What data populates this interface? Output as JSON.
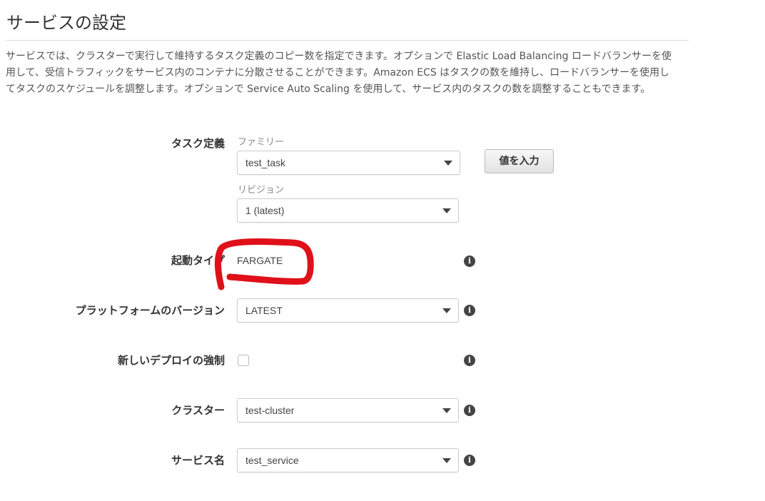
{
  "page": {
    "title": "サービスの設定",
    "description": "サービスでは、クラスターで実行して維持するタスク定義のコピー数を指定できます。オプションで Elastic Load Balancing ロードバランサーを使用して、受信トラフィックをサービス内のコンテナに分散させることができます。Amazon ECS はタスクの数を維持し、ロードバランサーを使用してタスクのスケジュールを調整します。オプションで Service Auto Scaling を使用して、サービス内のタスクの数を調整することもできます。"
  },
  "task_definition": {
    "label": "タスク定義",
    "family_label": "ファミリー",
    "family_value": "test_task",
    "enter_value_button": "値を入力",
    "revision_label": "リビジョン",
    "revision_value": "1 (latest)"
  },
  "launch_type": {
    "label": "起動タイプ",
    "value": "FARGATE",
    "annotation_color": "#e0101a"
  },
  "platform_version": {
    "label": "プラットフォームのバージョン",
    "value": "LATEST"
  },
  "force_new_deployment": {
    "label": "新しいデプロイの強制",
    "checked": false
  },
  "cluster": {
    "label": "クラスター",
    "value": "test-cluster"
  },
  "service_name": {
    "label": "サービス名",
    "value": "test_service"
  },
  "icons": {
    "info": "info-icon",
    "dropdown": "chevron-down-icon"
  }
}
